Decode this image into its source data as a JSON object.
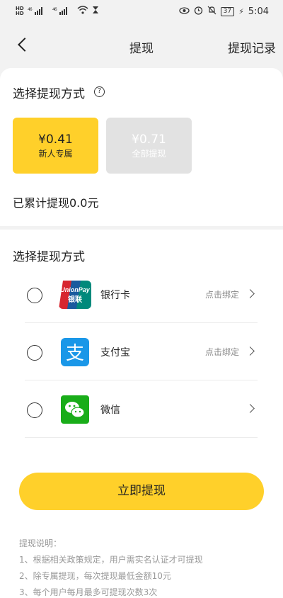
{
  "status_bar": {
    "hd_top": "HD",
    "hd_bottom": "HD",
    "net1": "46",
    "net2": "46",
    "battery": "37",
    "time": "5:04"
  },
  "nav": {
    "title": "提现",
    "right_link": "提现记录"
  },
  "withdraw_section": {
    "title": "选择提现方式",
    "options": [
      {
        "amount": "¥0.41",
        "label": "新人专属",
        "selected": true
      },
      {
        "amount": "¥0.71",
        "label": "全部提现",
        "selected": false
      }
    ],
    "total_text": "已累计提现0.0元"
  },
  "payment_section": {
    "title": "选择提现方式",
    "methods": [
      {
        "name": "银行卡",
        "action": "点击绑定",
        "icon": "unionpay-icon",
        "logo_top": "UnionPay",
        "logo_bottom": "银联"
      },
      {
        "name": "支付宝",
        "action": "点击绑定",
        "icon": "alipay-icon",
        "logo_glyph": "支"
      },
      {
        "name": "微信",
        "action": "",
        "icon": "wechat-icon"
      }
    ]
  },
  "submit_label": "立即提现",
  "notes": {
    "heading": "提现说明：",
    "items": [
      "1、根据相关政策规定，用户需实名认证才可提现",
      "2、除专属提现，每次提现最低金额10元",
      "3、每个用户每月最多可提现次数3次"
    ]
  },
  "colors": {
    "accent": "#ffd02a",
    "disabled": "#e2e2e2",
    "unionpay_red": "#d7262f",
    "unionpay_blue": "#1a5a9e",
    "unionpay_teal": "#00897b",
    "alipay": "#1a97e8",
    "wechat": "#19ad19"
  }
}
